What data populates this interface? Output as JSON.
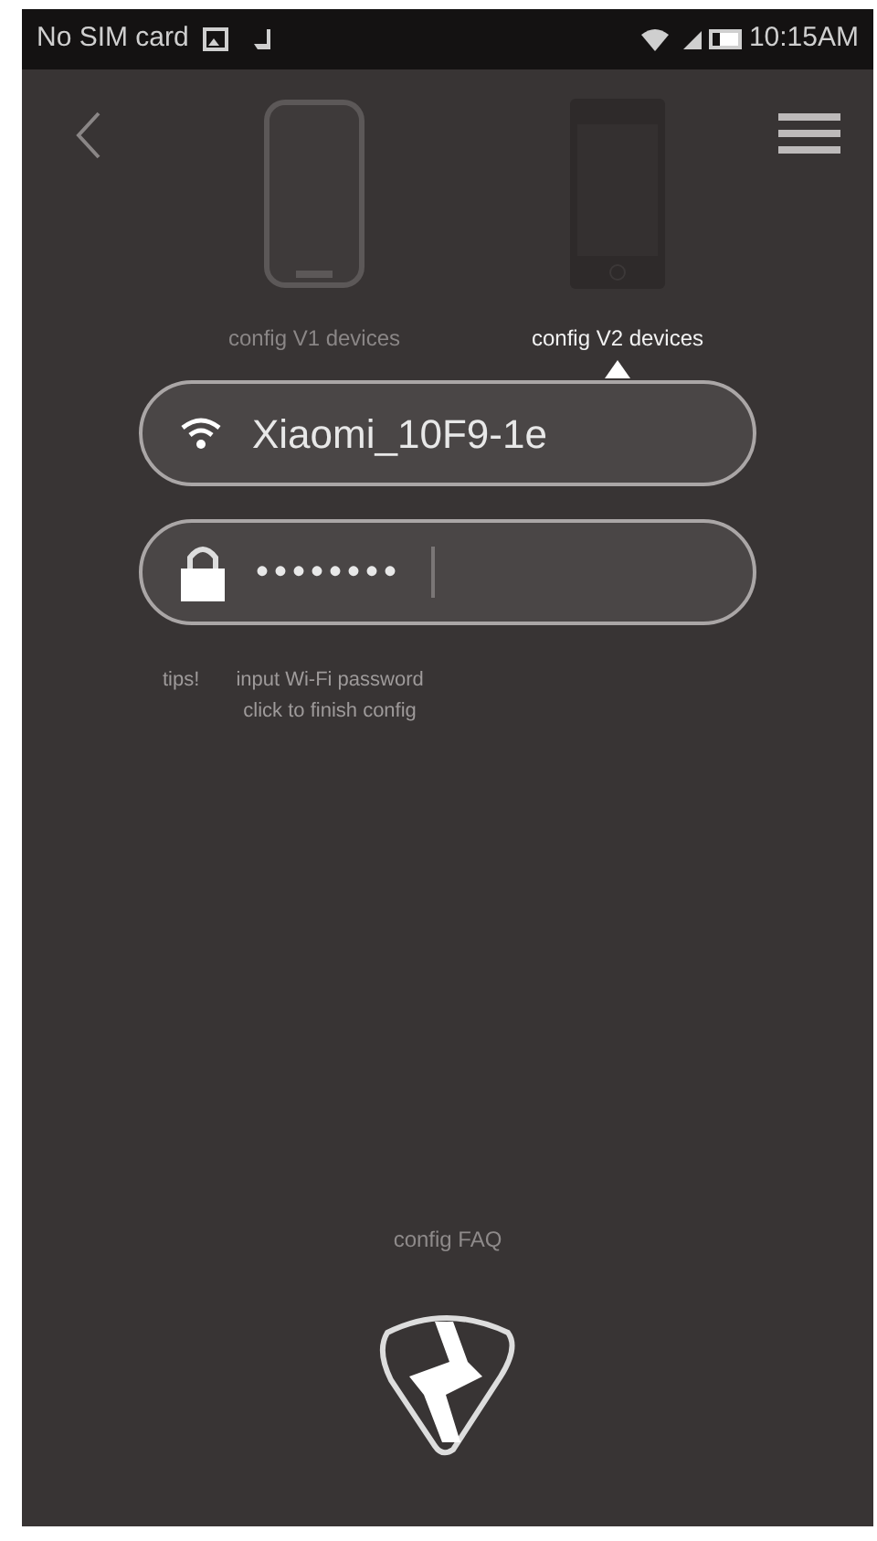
{
  "status_bar": {
    "carrier": "No SIM card",
    "time": "10:15AM"
  },
  "device_tabs": [
    {
      "label": "config V1 devices",
      "selected": false,
      "kind": "round"
    },
    {
      "label": "config V2 devices",
      "selected": true,
      "kind": "square"
    }
  ],
  "ssid_field": {
    "value": "Xiaomi_10F9-1e"
  },
  "password_field": {
    "value": "••••••••"
  },
  "hint": {
    "label": "tips!",
    "lines": [
      "input Wi-Fi password",
      "click to finish config"
    ]
  },
  "faq_link": "config FAQ"
}
